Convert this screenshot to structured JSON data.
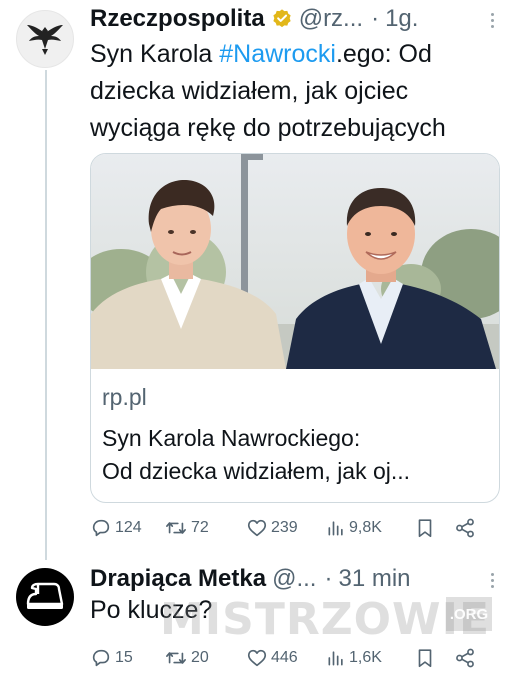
{
  "tweet1": {
    "author_name": "Rzeczpospolita",
    "handle": "@rz...",
    "separator": "·",
    "time": "1g.",
    "text_before": "Syn Karola ",
    "hashtag": "#Nawrocki",
    "text_after": ".ego: Od dziecka widziałem, jak ojciec wyciąga rękę do potrzebujących",
    "card": {
      "domain": "rp.pl",
      "title_line1": "Syn Karola Nawrockiego:",
      "title_line2": "Od dziecka widziałem, jak oj..."
    },
    "actions": {
      "replies": "124",
      "reposts": "72",
      "likes": "239",
      "views": "9,8K"
    },
    "icons": [
      "eagle-logo-icon",
      "verified-badge-icon",
      "more-icon",
      "reply-icon",
      "repost-icon",
      "like-icon",
      "views-icon",
      "bookmark-icon",
      "share-icon"
    ]
  },
  "tweet2": {
    "author_name": "Drapiąca Metka",
    "handle": "@...",
    "separator": "·",
    "time": "31 min",
    "text": "Po klucze?",
    "actions": {
      "replies": "15",
      "reposts": "20",
      "likes": "446",
      "views": "1,6K"
    },
    "icons": [
      "clothes-iron-icon",
      "more-icon",
      "reply-icon",
      "repost-icon",
      "like-icon",
      "views-icon",
      "bookmark-icon",
      "share-icon"
    ]
  },
  "watermark": {
    "text": "MISTRZOWIE",
    "suffix": ".ORG"
  },
  "colors": {
    "accent": "#1d9bf0",
    "text_primary": "#0f1419",
    "text_secondary": "#536471",
    "border": "#cfd9de",
    "verified_gold": "#e2b719"
  }
}
